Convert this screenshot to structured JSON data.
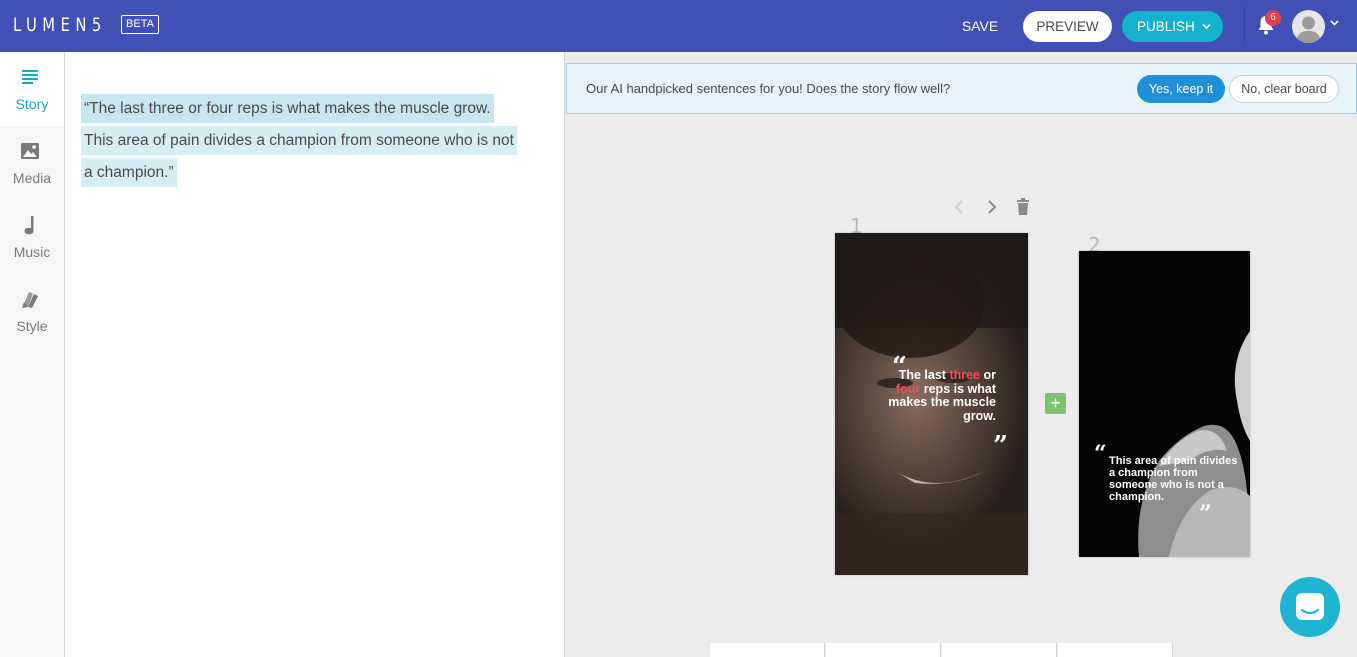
{
  "header": {
    "logo": "LUMEN5",
    "beta": "BETA",
    "save_label": "SAVE",
    "preview_label": "PREVIEW",
    "publish_label": "PUBLISH",
    "notifications_count": "6"
  },
  "sidebar": {
    "items": [
      {
        "label": "Story",
        "icon": "lines-icon",
        "active": true
      },
      {
        "label": "Media",
        "icon": "image-icon",
        "active": false
      },
      {
        "label": "Music",
        "icon": "music-note-icon",
        "active": false
      },
      {
        "label": "Style",
        "icon": "paint-swatch-icon",
        "active": false
      }
    ]
  },
  "story": {
    "sentence1": "“The last three or four reps is what makes the muscle grow.",
    "sentence2": "This area of pain divides a champion from someone who is not a champion.”"
  },
  "banner": {
    "text": "Our AI handpicked sentences for you! Does the story flow well?",
    "yes_label": "Yes, keep it",
    "no_label": "No, clear board"
  },
  "scenes": [
    {
      "number": "1",
      "caption_parts": [
        "The last ",
        "three",
        " or ",
        "four",
        " reps is what makes the muscle grow."
      ]
    },
    {
      "number": "2",
      "caption": "This area of pain divides a champion from someone who is not a champion."
    }
  ],
  "add_scene_label": "+",
  "colors": {
    "header": "#4050b5",
    "accent": "#15b2cf",
    "highlight": "#c6e7ef",
    "keyword": "#ef4d5a",
    "add": "#7dc46d",
    "badge": "#e23f4f"
  }
}
